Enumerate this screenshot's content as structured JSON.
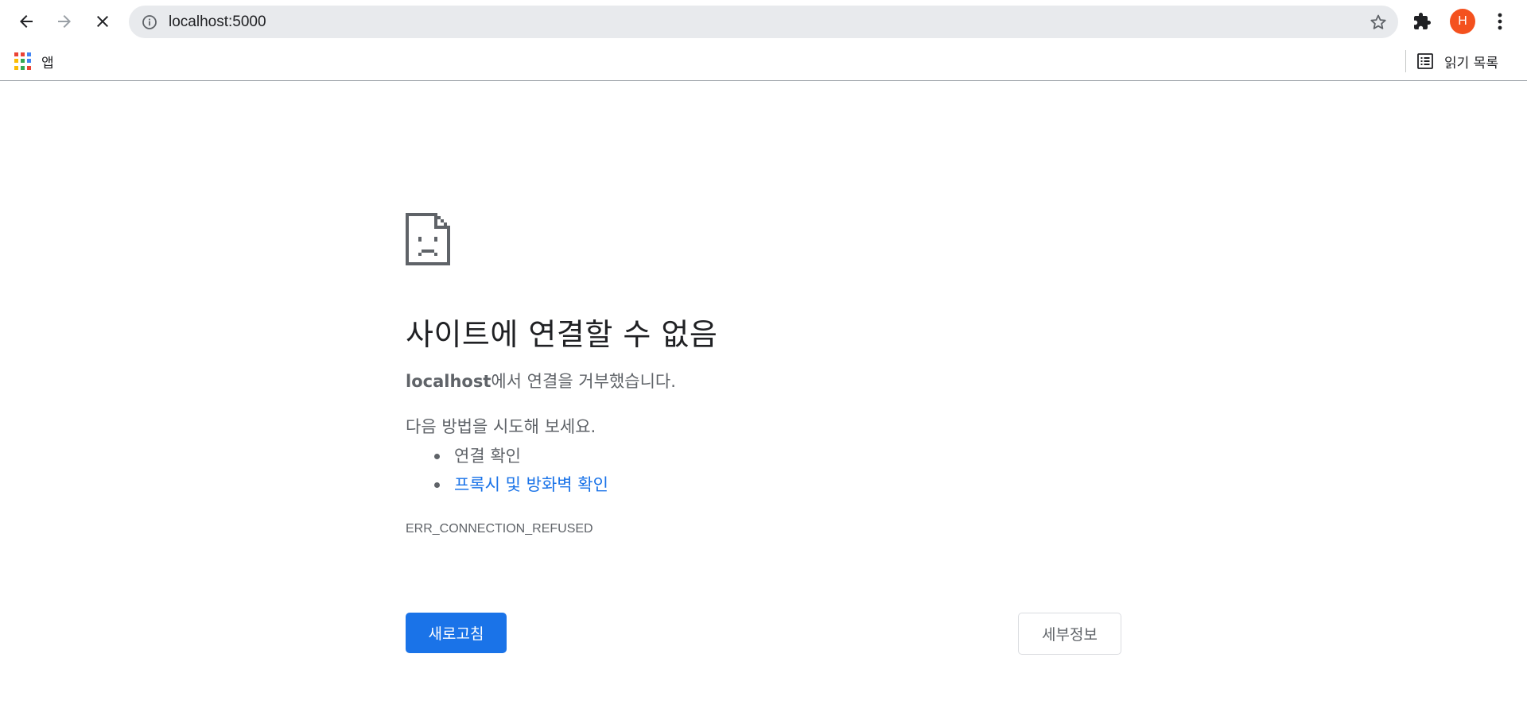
{
  "browser": {
    "address_bar": {
      "url": "localhost:5000"
    },
    "profile": {
      "initial": "H",
      "color": "#f4511e"
    },
    "icons": [
      "back-icon",
      "forward-icon",
      "stop-icon",
      "info-icon",
      "star-icon",
      "extensions-icon",
      "more-menu-icon"
    ]
  },
  "bookmarks_bar": {
    "apps_label": "앱",
    "reading_list_label": "읽기 목록"
  },
  "error_page": {
    "icon": "sad-document-icon",
    "title": "사이트에 연결할 수 없음",
    "summary_host": "localhost",
    "summary_text": "에서 연결을 거부했습니다.",
    "suggestions_heading": "다음 방법을 시도해 보세요.",
    "suggestions": [
      {
        "label": "연결 확인",
        "is_link": false
      },
      {
        "label": "프록시 및 방화벽 확인",
        "is_link": true
      }
    ],
    "error_code": "ERR_CONNECTION_REFUSED",
    "reload_button": "새로고침",
    "details_button": "세부정보"
  },
  "colors": {
    "primary": "#1a73e8",
    "text_secondary": "#5f6368",
    "omnibox_bg": "#e8eaed"
  }
}
